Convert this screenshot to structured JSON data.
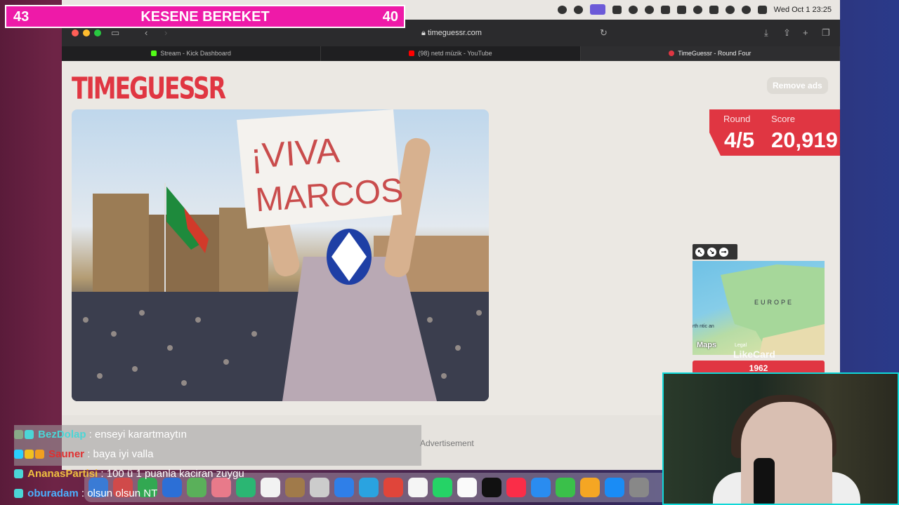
{
  "menubar": {
    "datetime": "Wed Oct 1  23:25"
  },
  "browser": {
    "url": "timeguessr.com",
    "tabs": [
      {
        "label": "Stream - Kick Dashboard",
        "color": "#53fc18"
      },
      {
        "label": "(98) netd müzik - YouTube",
        "color": "#ff0000"
      },
      {
        "label": "TimeGuessr - Round Four",
        "color": "#e03642"
      }
    ]
  },
  "page": {
    "logo": "TIMEGUESSR",
    "remove_ads": "Remove ads",
    "photo": {
      "sign_line1": "¡VIVA",
      "sign_line2": "MARCOS"
    },
    "round_label": "Round",
    "round_value": "4/5",
    "score_label": "Score",
    "score_value": "20,919",
    "map": {
      "region_label": "EUROPE",
      "attribution": "Maps",
      "legal": "Legal",
      "sea_fragment": "rth\nntic\nan"
    },
    "year_button": "1962",
    "advertisement": "Advertisement"
  },
  "overlay": {
    "banner": {
      "left": "43",
      "center": "KESENE BEREKET",
      "right": "40"
    },
    "likecard": "LikeCard",
    "chat": [
      {
        "user": "BezDolap",
        "user_color": "#4bd6d6",
        "message": "enseyi karartmaytın"
      },
      {
        "user": "Sauner",
        "user_color": "#e03030",
        "message": "baya iyi valla"
      },
      {
        "user": "AnanasPartisi",
        "user_color": "#f0c040",
        "message": "100 ü 1 puanla kaciran zuygu"
      },
      {
        "user": "oburadam",
        "user_color": "#4bb0ff",
        "message": "olsun olsun NT"
      }
    ]
  },
  "colors": {
    "accent": "#e03642",
    "banner": "#ee1aa8",
    "cam_border": "#10d8d8"
  }
}
